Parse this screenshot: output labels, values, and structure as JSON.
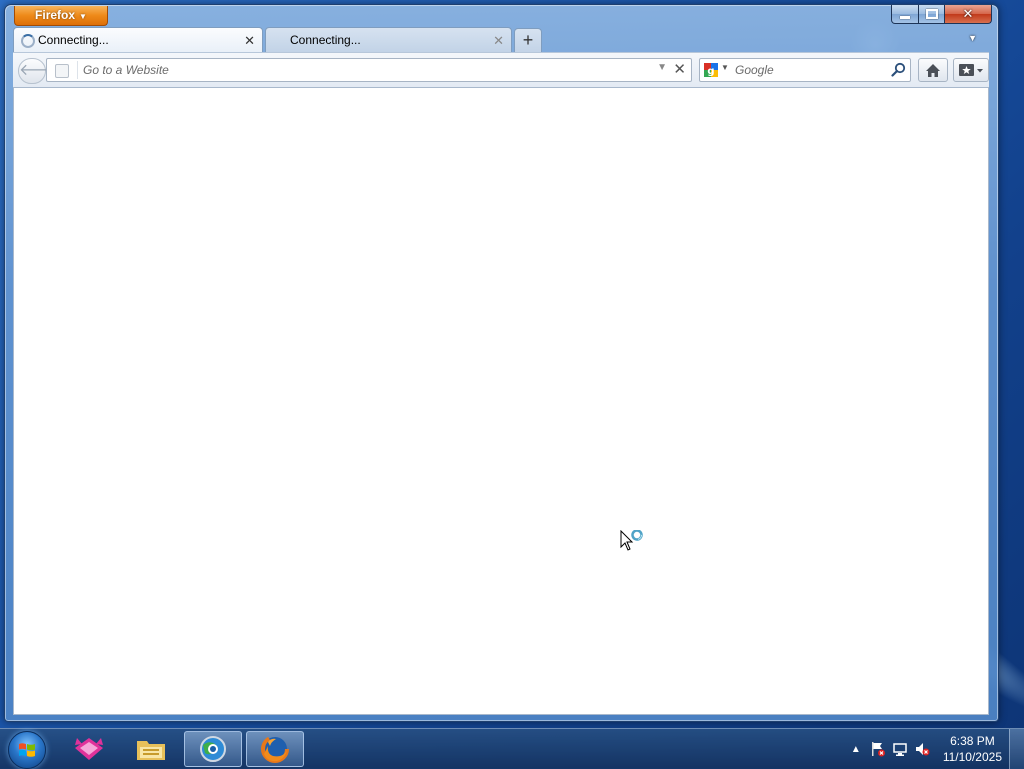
{
  "browser": {
    "app_button_label": "Firefox",
    "tabs": [
      {
        "title": "Connecting...",
        "active": true
      },
      {
        "title": "Connecting...",
        "active": false
      }
    ],
    "new_tab_label": "+",
    "urlbar": {
      "placeholder": "Go to a Website",
      "value": ""
    },
    "searchbar": {
      "placeholder": "Google",
      "engine": "google-icon"
    }
  },
  "taskbar": {
    "pinned": [
      "app-icon",
      "explorer-icon",
      "browser-icon",
      "firefox-icon"
    ],
    "clock": {
      "time": "6:38 PM",
      "date": "11/10/2025"
    },
    "tray_icons": [
      "show-hidden-icons-arrow",
      "action-center-icon",
      "network-icon",
      "volume-muted-icon"
    ]
  },
  "colors": {
    "desktop": "#1a54a8",
    "firefox_button": "#ee8a19",
    "close_button": "#c1391a"
  }
}
